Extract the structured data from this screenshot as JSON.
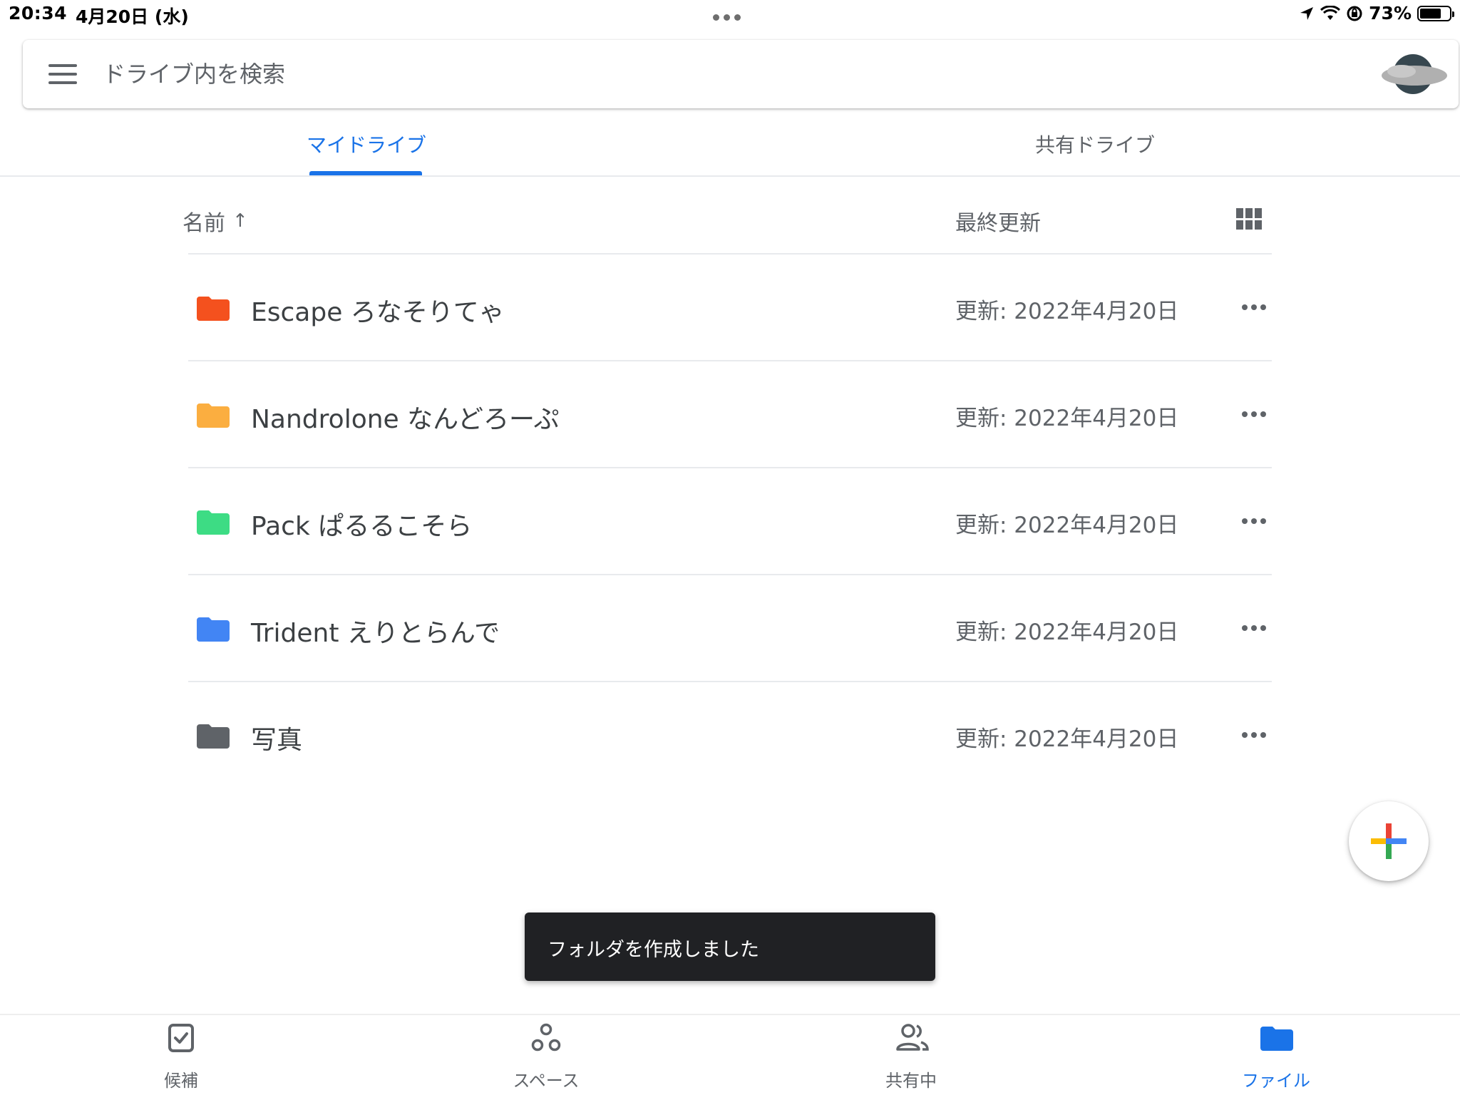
{
  "status_bar": {
    "time": "20:34",
    "date": "4月20日 (水)",
    "battery": "73%",
    "battery_level": 0.73
  },
  "search": {
    "placeholder": "ドライブ内を検索"
  },
  "tabs": {
    "my_drive": "マイドライブ",
    "shared_drives": "共有ドライブ",
    "active": "my_drive",
    "active_color": "#1a73e8"
  },
  "list_header": {
    "name": "名前",
    "sort_arrow": "↑",
    "modified": "最終更新"
  },
  "folders": [
    {
      "name": "Escape ろなそりてゃ",
      "modified": "更新: 2022年4月20日",
      "color": "#f4511e"
    },
    {
      "name": "Nandrolone なんどろーぷ",
      "modified": "更新: 2022年4月20日",
      "color": "#fbae40"
    },
    {
      "name": "Pack ぱるるこそら",
      "modified": "更新: 2022年4月20日",
      "color": "#3ddc84"
    },
    {
      "name": "Trident えりとらんで",
      "modified": "更新: 2022年4月20日",
      "color": "#4285f4"
    },
    {
      "name": "写真",
      "modified": "更新: 2022年4月20日",
      "color": "#5f6368"
    }
  ],
  "snackbar": {
    "text": "フォルダを作成しました"
  },
  "bottom_nav": {
    "items": [
      {
        "label": "候補",
        "icon": "suggested-icon"
      },
      {
        "label": "スペース",
        "icon": "spaces-icon"
      },
      {
        "label": "共有中",
        "icon": "shared-people-icon"
      },
      {
        "label": "ファイル",
        "icon": "folder-icon"
      }
    ],
    "active": 3
  }
}
